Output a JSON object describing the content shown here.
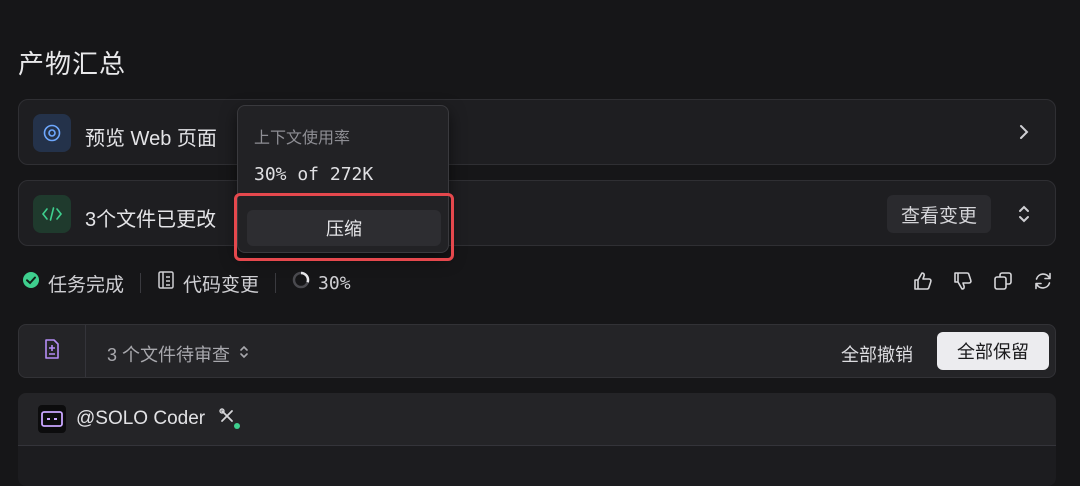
{
  "page": {
    "title": "产物汇总"
  },
  "preview_card": {
    "label": "预览 Web 页面",
    "icon": "compass-icon"
  },
  "files_card": {
    "label": "3个文件已更改",
    "icon": "code-icon",
    "view_changes_label": "查看变更"
  },
  "status": {
    "task_done": "任务完成",
    "code_changes": "代码变更",
    "context_percent": "30%",
    "context_fraction": 0.3,
    "accent_green": "#3ecf8e"
  },
  "review": {
    "label": "3 个文件待审查",
    "undo_all": "全部撤销",
    "keep_all": "全部保留"
  },
  "coder": {
    "name": "@SOLO Coder"
  },
  "popup": {
    "title": "上下文使用率",
    "value": "30% of 272K",
    "compress_label": "压缩"
  },
  "colors": {
    "highlight": "#e5484d",
    "compass_blue": "#6ea8fe"
  }
}
